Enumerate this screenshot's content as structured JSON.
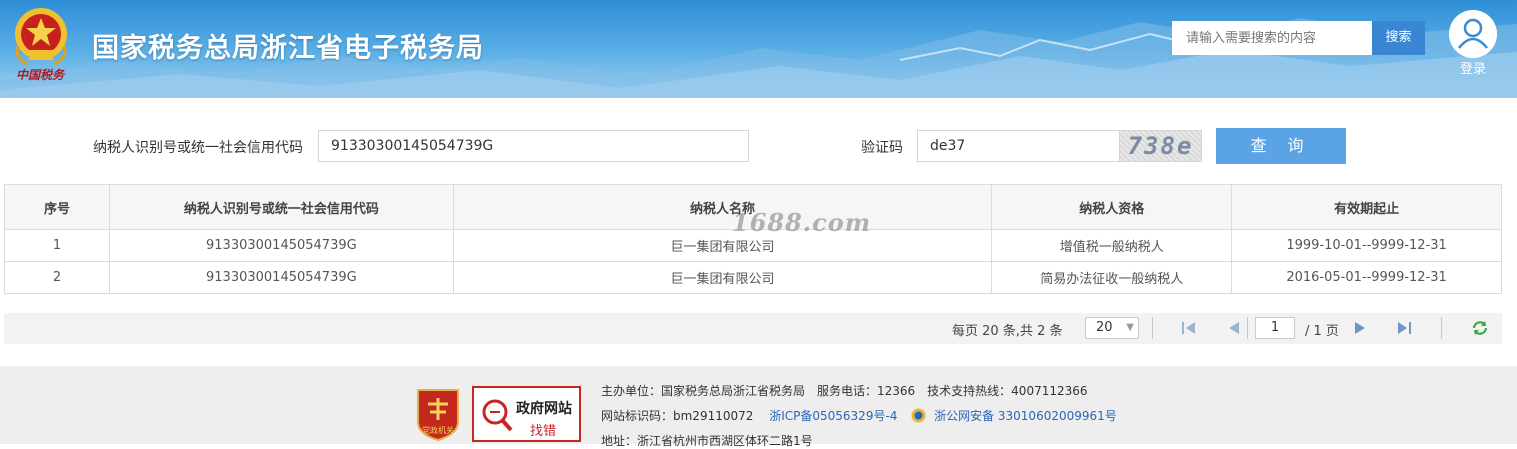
{
  "header": {
    "title": "国家税务总局浙江省电子税务局",
    "emblem_caption": "中国税务",
    "search": {
      "placeholder": "请输入需要搜索的内容",
      "button_label": "搜索"
    },
    "login_label": "登录"
  },
  "query": {
    "taxid_label": "纳税人识别号或统一社会信用代码",
    "taxid_value": "91330300145054739G",
    "captcha_label": "验证码",
    "captcha_value": "de37",
    "captcha_image_text": "738e",
    "submit_label": "查 询"
  },
  "table": {
    "headers": [
      "序号",
      "纳税人识别号或统一社会信用代码",
      "纳税人名称",
      "纳税人资格",
      "有效期起止"
    ],
    "rows": [
      [
        "1",
        "91330300145054739G",
        "巨一集团有限公司",
        "增值税一般纳税人",
        "1999-10-01--9999-12-31"
      ],
      [
        "2",
        "91330300145054739G",
        "巨一集团有限公司",
        "简易办法征收一般纳税人",
        "2016-05-01--9999-12-31"
      ]
    ]
  },
  "watermark": "1688.com",
  "pagination": {
    "summary": "每页 20 条,共 2 条",
    "page_size": "20",
    "current_page": "1",
    "total_pages": "/ 1 页"
  },
  "footer": {
    "line1": "主办单位：国家税务总局浙江省税务局　服务电话：12366　技术支持热线：4007112366",
    "site_code": "网站标识码：bm29110072",
    "icp": "浙ICP备05056329号-4",
    "police": "浙公网安备 33010602009961号",
    "address": "地址：浙江省杭州市西湖区体环二路1号",
    "badge_label": "党政机关",
    "gov_line1": "政府网站",
    "gov_line2": "找错"
  },
  "colors": {
    "header_blue": "#2e8fd6",
    "button_blue": "#5aa4e6",
    "search_button": "#3a86d2",
    "footer_bg": "#eeeeee",
    "link": "#2a66b8",
    "emblem_red": "#b3181e"
  },
  "icons": [
    "emblem-icon",
    "user-icon",
    "first-page-icon",
    "prev-page-icon",
    "next-page-icon",
    "last-page-icon",
    "refresh-icon",
    "party-badge-icon",
    "magnifier-icon",
    "police-badge-icon"
  ]
}
